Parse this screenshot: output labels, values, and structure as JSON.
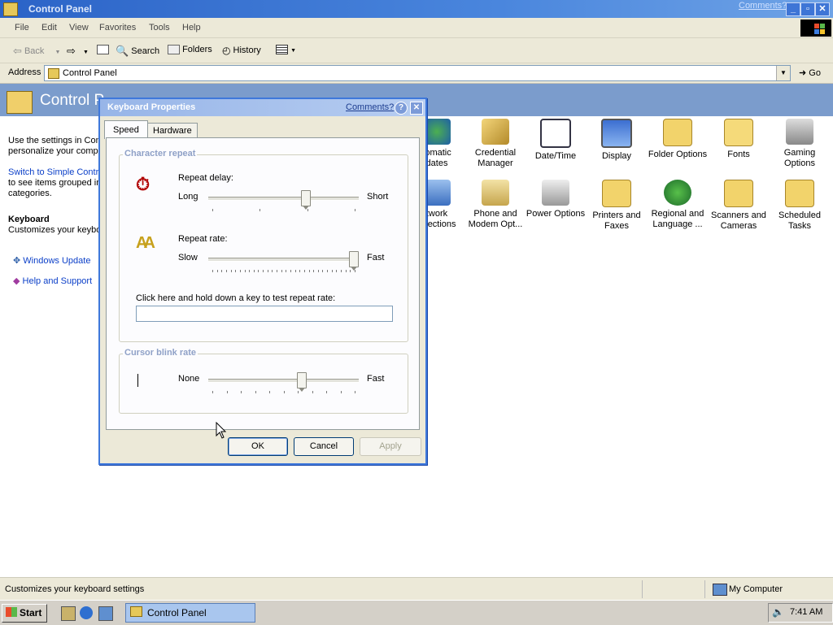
{
  "window": {
    "title": "Control Panel",
    "comments_link": "Comments?"
  },
  "menu": [
    "File",
    "Edit",
    "View",
    "Favorites",
    "Tools",
    "Help"
  ],
  "toolbar": {
    "back": "Back",
    "search": "Search",
    "folders": "Folders",
    "history": "History"
  },
  "address": {
    "label": "Address",
    "value": "Control Panel",
    "go": "Go"
  },
  "left_pane": {
    "banner_title": "Control P",
    "intro_lines": [
      "Use the settings in Con",
      "personalize your compu"
    ],
    "switch_link": "Switch to Simple Contro",
    "switch_rest": [
      "to see items grouped in",
      "categories."
    ],
    "selected_title": "Keyboard",
    "selected_desc": "Customizes your keybo",
    "links": [
      "Windows Update",
      "Help and Support"
    ]
  },
  "icons": [
    {
      "label": "Automatic Updates",
      "l1": "tomatic",
      "l2": "dates"
    },
    {
      "label": "Credential Manager",
      "l1": "Credential",
      "l2": "Manager"
    },
    {
      "label": "Date/Time",
      "l1": "Date/Time",
      "l2": ""
    },
    {
      "label": "Display",
      "l1": "Display",
      "l2": ""
    },
    {
      "label": "Folder Options",
      "l1": "Folder Options",
      "l2": ""
    },
    {
      "label": "Fonts",
      "l1": "Fonts",
      "l2": ""
    },
    {
      "label": "Gaming Options",
      "l1": "Gaming",
      "l2": "Options"
    },
    {
      "label": "Network Connections",
      "l1": "twork",
      "l2": "nnections"
    },
    {
      "label": "Phone and Modem Opt...",
      "l1": "Phone and",
      "l2": "Modem Opt..."
    },
    {
      "label": "Power Options",
      "l1": "Power Options",
      "l2": ""
    },
    {
      "label": "Printers and Faxes",
      "l1": "Printers and",
      "l2": "Faxes"
    },
    {
      "label": "Regional and Language ...",
      "l1": "Regional and",
      "l2": "Language ..."
    },
    {
      "label": "Scanners and Cameras",
      "l1": "Scanners and",
      "l2": "Cameras"
    },
    {
      "label": "Scheduled Tasks",
      "l1": "Scheduled",
      "l2": "Tasks"
    }
  ],
  "dialog": {
    "title": "Keyboard Properties",
    "comments": "Comments?",
    "tabs": [
      "Speed",
      "Hardware"
    ],
    "char_repeat": {
      "group": "Character repeat",
      "delay_label": "Repeat delay:",
      "delay_min": "Long",
      "delay_max": "Short",
      "delay_value": 0.66,
      "rate_label": "Repeat rate:",
      "rate_min": "Slow",
      "rate_max": "Fast",
      "rate_value": 1.0,
      "test_label": "Click here and hold down a key to test repeat rate:",
      "test_value": ""
    },
    "cursor_blink": {
      "group": "Cursor blink rate",
      "min": "None",
      "max": "Fast",
      "value": 0.63
    },
    "buttons": {
      "ok": "OK",
      "cancel": "Cancel",
      "apply": "Apply"
    }
  },
  "status": {
    "text": "Customizes your keyboard settings",
    "zone": "My Computer"
  },
  "taskbar": {
    "start": "Start",
    "task": "Control Panel",
    "clock": "7:41 AM"
  }
}
